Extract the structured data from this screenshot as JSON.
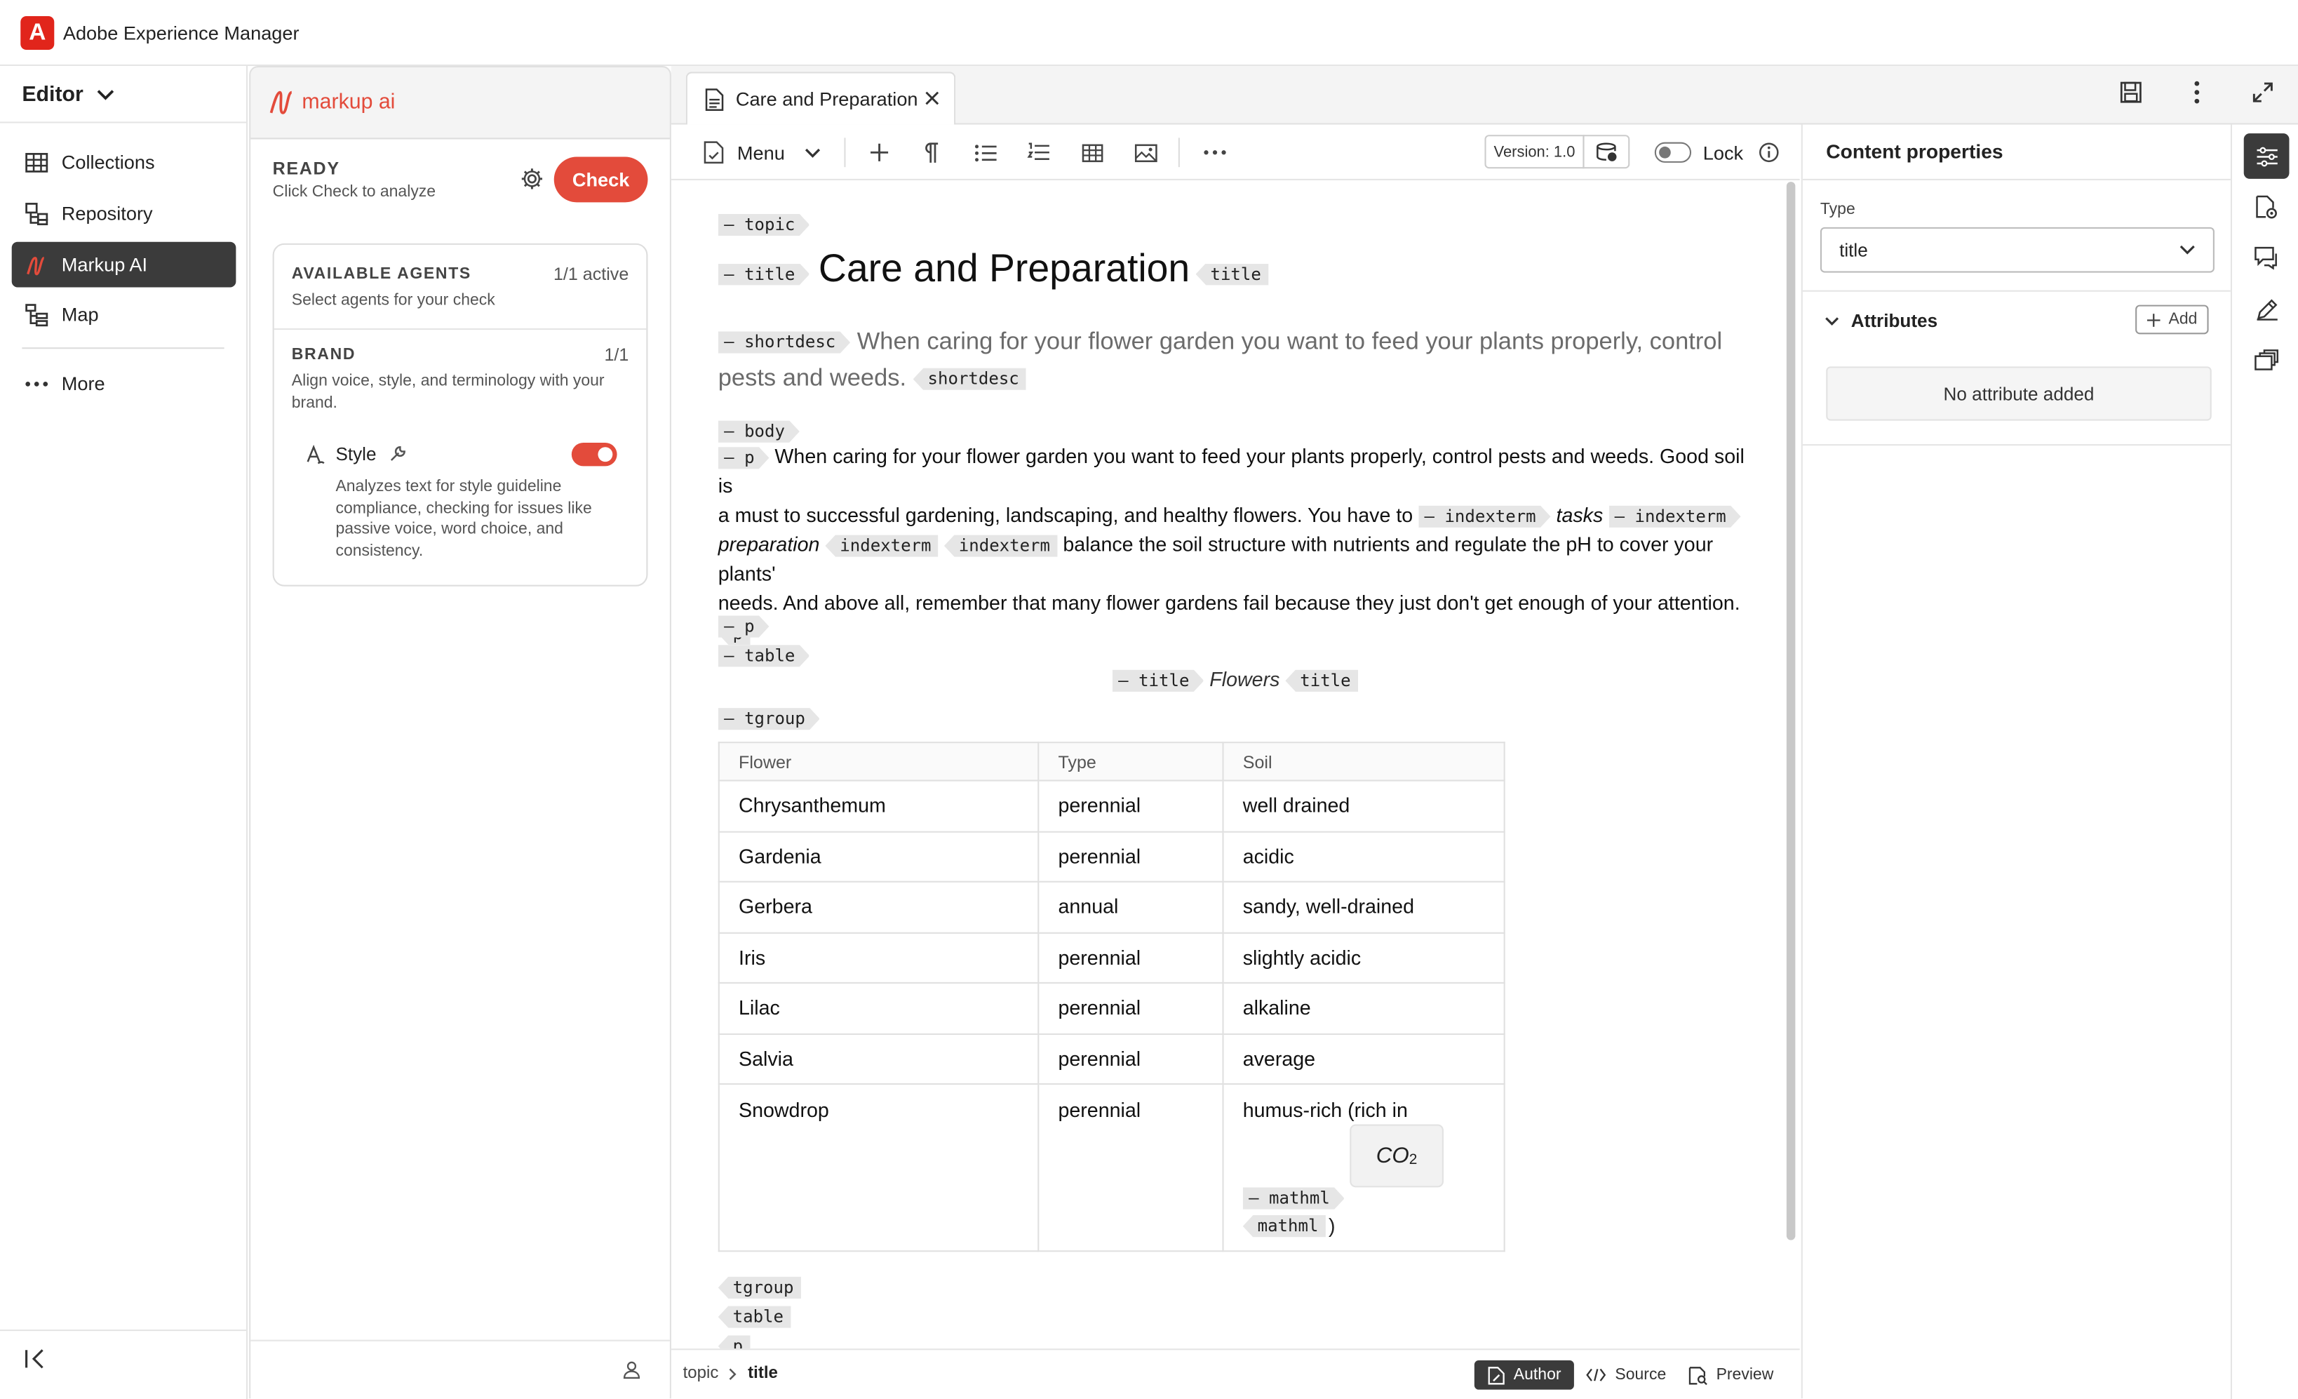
{
  "app": {
    "title": "Adobe Experience Manager",
    "logo_letter": "A"
  },
  "leftnav": {
    "switcher_label": "Editor",
    "items": [
      {
        "label": "Collections",
        "icon": "table-icon"
      },
      {
        "label": "Repository",
        "icon": "repository-icon"
      },
      {
        "label": "Markup AI",
        "icon": "markup-ai-icon",
        "active": true
      },
      {
        "label": "Map",
        "icon": "map-icon"
      }
    ],
    "more_label": "More"
  },
  "markup": {
    "brand_name": "markup ai",
    "status_title": "READY",
    "status_sub": "Click Check to analyze",
    "check_label": "Check",
    "agents_title": "AVAILABLE AGENTS",
    "agents_count": "1/1 active",
    "agents_sub": "Select agents for your check",
    "brand_title": "BRAND",
    "brand_count": "1/1",
    "brand_sub": "Align voice, style, and terminology with your brand.",
    "style_label": "Style",
    "style_enabled": true,
    "style_desc": "Analyzes text for style guideline compliance, checking for issues like passive voice, word choice, and consistency."
  },
  "editor": {
    "tab_title": "Care and Preparation",
    "menu_label": "Menu",
    "version_label": "Version: 1.0",
    "lock_label": "Lock",
    "doc": {
      "topic_tag": "topic",
      "title_tag": "title",
      "title": "Care and Preparation",
      "shortdesc_tag": "shortdesc",
      "shortdesc_line1": "When caring for your flower garden you want to feed your plants properly, control",
      "shortdesc_line2": "pests and weeds.",
      "body_tag": "body",
      "p_tag": "p",
      "para_part1": "When caring for your flower garden you want to feed your plants properly, control pests and weeds. Good soil is",
      "para_part2": "a must to successful gardening, landscaping, and healthy flowers. You have to",
      "indexterm_tag": "indexterm",
      "tasks_word": "tasks",
      "preparation_word": "preparation",
      "para_part3": "balance the soil structure with nutrients and regulate the pH to cover your plants'",
      "para_part4": "needs. And above all, remember that many flower gardens fail because they just don't get enough of your attention.",
      "table_tag": "table",
      "table_title": "Flowers",
      "tgroup_tag": "tgroup",
      "mathml_tag": "mathml",
      "co2_text": "CO",
      "co2_sub": "2",
      "close_paren": ")",
      "table": {
        "headers": [
          "Flower",
          "Type",
          "Soil"
        ],
        "rows": [
          [
            "Chrysanthemum",
            "perennial",
            "well drained"
          ],
          [
            "Gardenia",
            "perennial",
            "acidic"
          ],
          [
            "Gerbera",
            "annual",
            "sandy, well-drained"
          ],
          [
            "Iris",
            "perennial",
            "slightly acidic"
          ],
          [
            "Lilac",
            "perennial",
            "alkaline"
          ],
          [
            "Salvia",
            "perennial",
            "average"
          ],
          [
            "Snowdrop",
            "perennial",
            "humus-rich (rich in"
          ]
        ]
      }
    },
    "breadcrumb": [
      "topic",
      "title"
    ],
    "modes": {
      "author": "Author",
      "source": "Source",
      "preview": "Preview"
    }
  },
  "properties": {
    "title": "Content properties",
    "type_label": "Type",
    "type_value": "title",
    "attributes_label": "Attributes",
    "add_label": "Add",
    "empty_label": "No attribute added"
  },
  "colors": {
    "accent": "#e34b3b",
    "brand_red": "#e1251b",
    "active_nav": "#3b3b3b"
  }
}
